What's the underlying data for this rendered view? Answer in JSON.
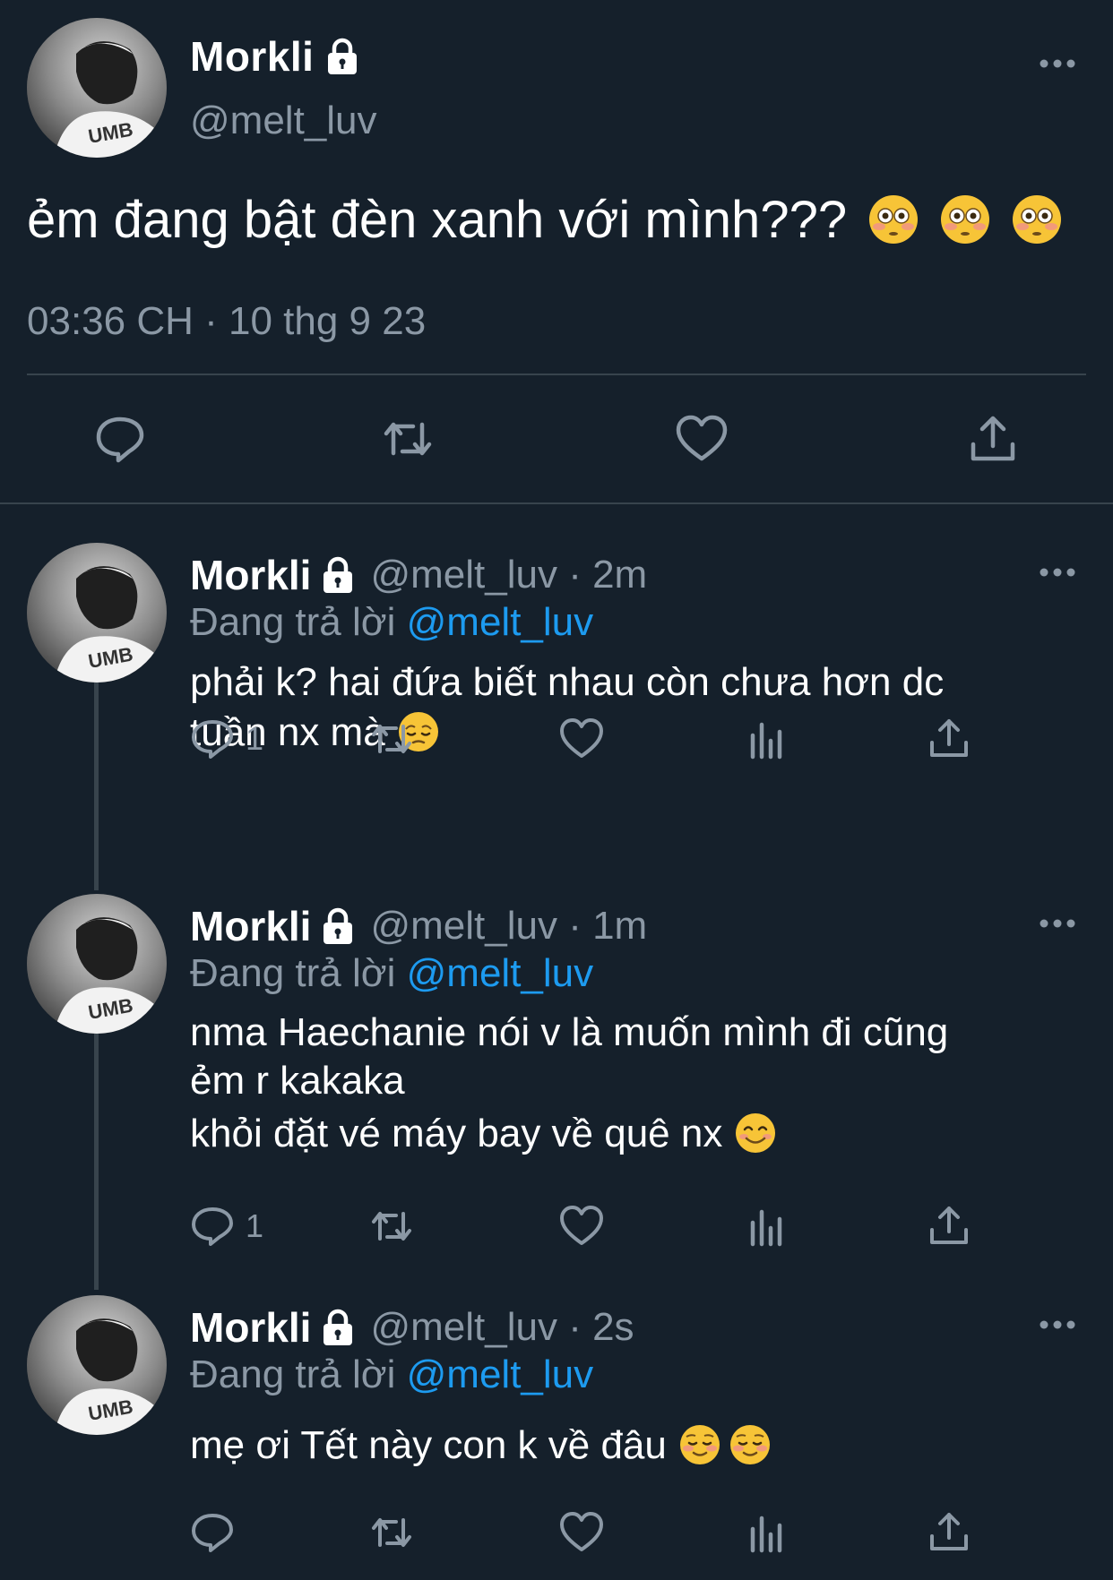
{
  "colors": {
    "background": "#15202b",
    "text": "#ffffff",
    "secondary": "#8b98a5",
    "accent": "#1d9bf0",
    "divider": "#38444d"
  },
  "main_tweet": {
    "name": "Morkli",
    "handle": "@melt_luv",
    "text": "ẻm đang bật đèn xanh với mình???",
    "emojis": [
      "flushed-face-emoji",
      "flushed-face-emoji",
      "flushed-face-emoji"
    ],
    "timestamp": "03:36 CH · 10 thg 9 23",
    "actions": [
      "reply-icon",
      "retweet-icon",
      "like-icon",
      "share-icon"
    ]
  },
  "replies": [
    {
      "name": "Morkli",
      "handle_time": "@melt_luv · 2m",
      "replying_prefix": "Đang trả lời",
      "replying_to": "@melt_luv",
      "lines": [
        "phải k? hai đứa biết nhau còn chưa hơn dc",
        "tuần nx mà"
      ],
      "emoji": "pensive-face-emoji",
      "reply_count": "1"
    },
    {
      "name": "Morkli",
      "handle_time": "@melt_luv · 1m",
      "replying_prefix": "Đang trả lời",
      "replying_to": "@melt_luv",
      "lines": [
        "nma Haechanie nói v là muốn mình đi cũng",
        "ẻm r kakaka",
        "khỏi đặt vé máy bay về quê nx"
      ],
      "emoji": "smiling-face-emoji",
      "reply_count": "1"
    },
    {
      "name": "Morkli",
      "handle_time": "@melt_luv · 2s",
      "replying_prefix": "Đang trả lời",
      "replying_to": "@melt_luv",
      "lines": [
        "mẹ ơi Tết này con k về đâu"
      ],
      "emoji": "relieved-blush-emoji",
      "reply_count": ""
    }
  ]
}
